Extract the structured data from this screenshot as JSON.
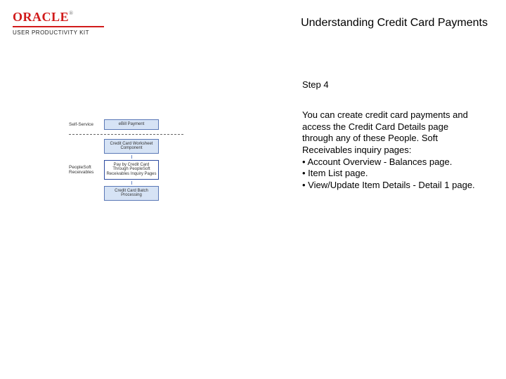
{
  "logo": {
    "brand": "ORACLE",
    "reg": "®",
    "subtitle": "USER PRODUCTIVITY KIT"
  },
  "title": "Understanding Credit Card Payments",
  "step_label": "Step 4",
  "body": {
    "p1": "You can create credit card payments and access the Credit Card Details page through any of these People. Soft Receivables inquiry pages:",
    "li1": "• Account Overview - Balances page.",
    "li2": "• Item List page.",
    "li3": "• View/Update Item Details - Detail 1 page."
  },
  "flow": {
    "section1": "Self-Service",
    "section2a": "PeopleSoft",
    "section2b": "Receivables",
    "box1": "eBill Payment",
    "box2": "Credit Card Worksheet Component",
    "box3": "Pay by Credit Card Through PeopleSoft Receivables Inquiry Pages",
    "box4": "Credit Card Batch Processing"
  }
}
